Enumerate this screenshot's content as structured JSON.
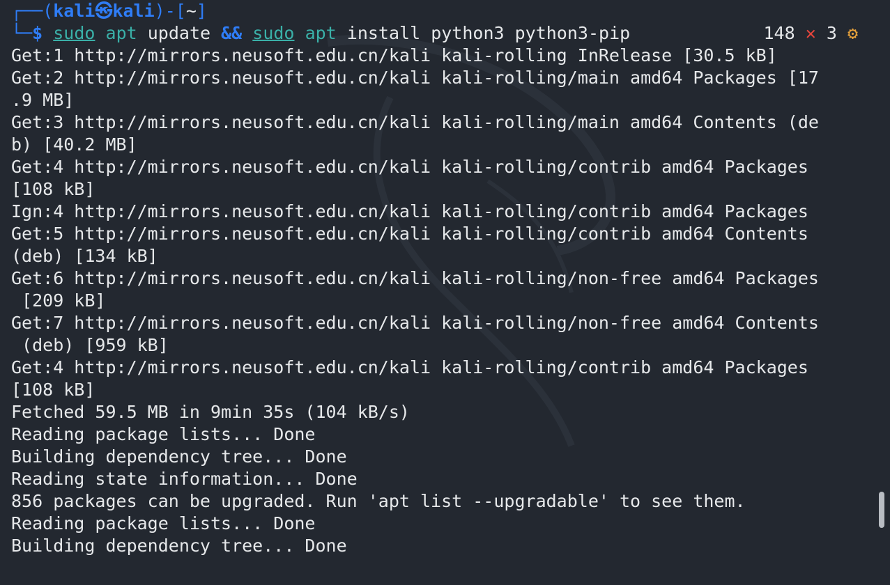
{
  "prompt": {
    "box_top": "┌──(",
    "user": "kali",
    "at": "㉿",
    "host": "kali",
    "dir_open": ")-[",
    "dir": "~",
    "dir_close": "]",
    "box_bottom": "└─",
    "dollar": "$",
    "command": {
      "t1": "sudo",
      "t2": "apt",
      "t3": "update",
      "t4": "&&",
      "t5": "sudo",
      "t6": "apt",
      "t7": "install python3 python3-pip"
    }
  },
  "status": {
    "count": "148",
    "x": "✕",
    "exit": "3",
    "gear": "⚙"
  },
  "output": [
    "Get:1 http://mirrors.neusoft.edu.cn/kali kali-rolling InRelease [30.5 kB]",
    "Get:2 http://mirrors.neusoft.edu.cn/kali kali-rolling/main amd64 Packages [17",
    ".9 MB]",
    "Get:3 http://mirrors.neusoft.edu.cn/kali kali-rolling/main amd64 Contents (de",
    "b) [40.2 MB]",
    "Get:4 http://mirrors.neusoft.edu.cn/kali kali-rolling/contrib amd64 Packages",
    "[108 kB]",
    "Ign:4 http://mirrors.neusoft.edu.cn/kali kali-rolling/contrib amd64 Packages",
    "Get:5 http://mirrors.neusoft.edu.cn/kali kali-rolling/contrib amd64 Contents",
    "(deb) [134 kB]",
    "Get:6 http://mirrors.neusoft.edu.cn/kali kali-rolling/non-free amd64 Packages",
    " [209 kB]",
    "Get:7 http://mirrors.neusoft.edu.cn/kali kali-rolling/non-free amd64 Contents",
    " (deb) [959 kB]",
    "Get:4 http://mirrors.neusoft.edu.cn/kali kali-rolling/contrib amd64 Packages",
    "[108 kB]",
    "Fetched 59.5 MB in 9min 35s (104 kB/s)",
    "Reading package lists... Done",
    "Building dependency tree... Done",
    "Reading state information... Done",
    "856 packages can be upgraded. Run 'apt list --upgradable' to see them.",
    "Reading package lists... Done",
    "Building dependency tree... Done"
  ]
}
